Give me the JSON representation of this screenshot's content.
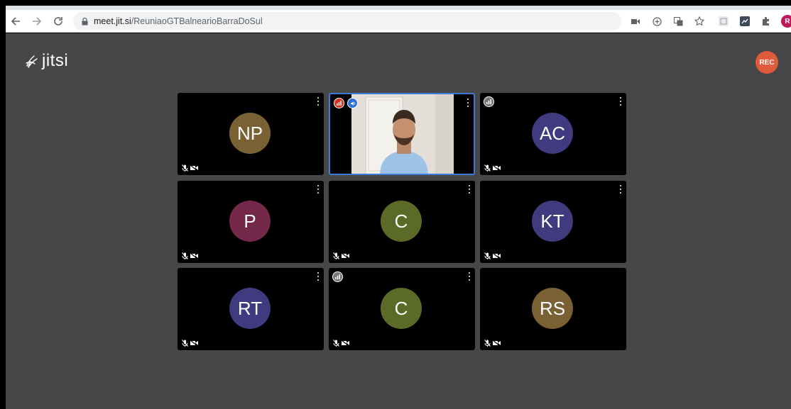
{
  "browser": {
    "url_host": "meet.jit.si",
    "url_path": "/ReuniaoGTBalnearioBarraDoSul",
    "profile_initial": "R",
    "icons": [
      "back-arrow-icon",
      "forward-arrow-icon",
      "reload-icon",
      "lock-icon",
      "camera-icon",
      "install-icon",
      "translate-icon",
      "star-icon",
      "extension-icon",
      "screenshot-icon",
      "puzzle-icon",
      "more-vert-icon"
    ]
  },
  "app": {
    "logo": "jitsi",
    "rec_label": "REC"
  },
  "colors": {
    "background": "#474747",
    "tile": "#000000",
    "active_border": "#3e7bd6",
    "rec": "#e05a3c"
  },
  "tiles": [
    {
      "initials": "NP",
      "avatar_color": "#7a6134",
      "muted": true,
      "video_off": true,
      "connection": null
    },
    {
      "initials": "",
      "avatar_color": null,
      "muted": false,
      "video_off": false,
      "connection": "poor",
      "dominant_speaker": true,
      "has_video": true
    },
    {
      "initials": "AC",
      "avatar_color": "#3f3b7e",
      "muted": true,
      "video_off": true,
      "connection": "neutral"
    },
    {
      "initials": "P",
      "avatar_color": "#74294a",
      "muted": true,
      "video_off": true,
      "connection": null
    },
    {
      "initials": "C",
      "avatar_color": "#5b6a27",
      "muted": true,
      "video_off": true,
      "connection": null
    },
    {
      "initials": "KT",
      "avatar_color": "#3f3b7e",
      "muted": true,
      "video_off": true,
      "connection": null
    },
    {
      "initials": "RT",
      "avatar_color": "#3f3b7e",
      "muted": true,
      "video_off": true,
      "connection": null
    },
    {
      "initials": "C",
      "avatar_color": "#5b6a27",
      "muted": true,
      "video_off": true,
      "connection": "neutral"
    },
    {
      "initials": "RS",
      "avatar_color": "#7a6134",
      "muted": true,
      "video_off": true,
      "connection": null
    }
  ]
}
